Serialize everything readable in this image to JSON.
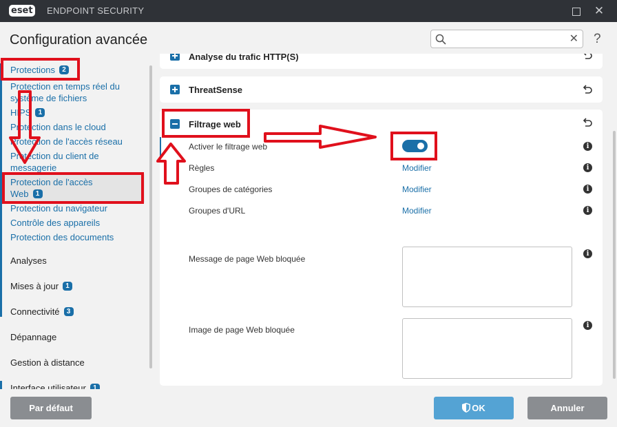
{
  "window": {
    "logo": "eset",
    "app_title": "ENDPOINT SECURITY",
    "maximize_icon": "maximize-icon",
    "close_icon": "close-icon"
  },
  "header": {
    "title": "Configuration avancée",
    "search": {
      "value": "",
      "placeholder": ""
    },
    "help": "?"
  },
  "sidebar": {
    "items": [
      {
        "label": "Protections",
        "badge": "2"
      },
      {
        "label": "Protection en temps réel du",
        "label2": "système de fichiers"
      },
      {
        "label": "HIPS",
        "badge": "1"
      },
      {
        "label": "Protection dans le cloud"
      },
      {
        "label": "Protection de l'accès réseau"
      },
      {
        "label": "Protection du client de",
        "label2": "messagerie"
      },
      {
        "label": "Protection de l'accès",
        "label2": "Web",
        "badge": "1"
      },
      {
        "label": "Protection du navigateur"
      },
      {
        "label": "Contrôle des appareils"
      },
      {
        "label": "Protection des documents"
      },
      {
        "label": "Analyses"
      },
      {
        "label": "Mises à jour",
        "badge": "1"
      },
      {
        "label": "Connectivité",
        "badge": "3"
      },
      {
        "label": "Dépannage"
      },
      {
        "label": "Gestion à distance"
      },
      {
        "label": "Interface utilisateur",
        "badge": "1"
      }
    ]
  },
  "main": {
    "sections": [
      {
        "title": "Analyse du trafic HTTP(S)"
      },
      {
        "title": "ThreatSense"
      },
      {
        "title": "Filtrage web"
      }
    ],
    "rows": [
      {
        "label": "Activer le filtrage web",
        "toggle_on": true
      },
      {
        "label": "Règles",
        "link": "Modifier"
      },
      {
        "label": "Groupes de catégories",
        "link": "Modifier"
      },
      {
        "label": "Groupes d'URL",
        "link": "Modifier"
      },
      {
        "label": "Message de page Web bloquée",
        "value": ""
      },
      {
        "label": "Image de page Web bloquée",
        "value": ""
      }
    ],
    "info_glyph": "i"
  },
  "footer": {
    "default_label": "Par défaut",
    "ok_label": "OK",
    "cancel_label": "Annuler"
  },
  "colors": {
    "accent": "#1a6fa8",
    "highlight": "#e0101c",
    "titlebar": "#2f3237"
  }
}
